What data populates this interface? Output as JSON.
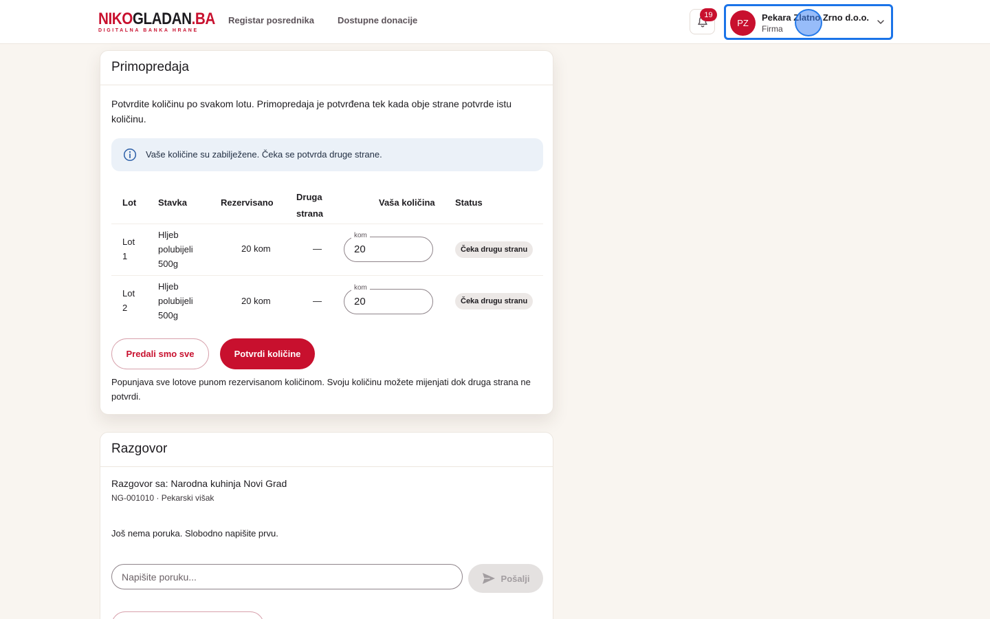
{
  "header": {
    "logo": {
      "main_a": "NIKO",
      "main_b": "GLADAN",
      "main_c": ".BA",
      "sub": "DIGITALNA BANKA HRANE"
    },
    "nav": [
      "Registar posrednika",
      "Dostupne donacije"
    ],
    "notifications": {
      "icon": "bell-icon",
      "count": "19"
    },
    "account": {
      "initials": "PZ",
      "name": "Pekara Zlatno Zrno d.o.o.",
      "role": "Firma",
      "icon": "chevron-down-icon"
    }
  },
  "handover": {
    "title": "Primopredaja",
    "intro": "Potvrdite količinu po svakom lotu. Primopredaja je potvrđena tek kada obje strane potvrde istu količinu.",
    "info": "Vaše količine su zabilježene. Čeka se potvrda druge strane.",
    "columns": {
      "lot": "Lot",
      "item": "Stavka",
      "reserved": "Rezervisano",
      "other_a": "Druga",
      "other_b": "strana",
      "yours": "Vaša količina",
      "status": "Status"
    },
    "rows": [
      {
        "lot_a": "Lot",
        "lot_b": "1",
        "item_a": "Hljeb",
        "item_b": "polubijeli",
        "item_c": "500g",
        "reserved": "20 kom",
        "other": "—",
        "unit": "kom",
        "qty": "20",
        "status": "Čeka drugu stranu"
      },
      {
        "lot_a": "Lot",
        "lot_b": "2",
        "item_a": "Hljeb",
        "item_b": "polubijeli",
        "item_c": "500g",
        "reserved": "20 kom",
        "other": "—",
        "unit": "kom",
        "qty": "20",
        "status": "Čeka drugu stranu"
      }
    ],
    "btn_all": "Predali smo sve",
    "btn_confirm": "Potvrdi količine",
    "hint": "Popunjava sve lotove punom rezervisanom količinom. Svoju količinu možete mijenjati dok druga strana ne potvrdi."
  },
  "conversation": {
    "title": "Razgovor",
    "with": "Razgovor sa: Narodna kuhinja Novi Grad",
    "ref": "NG-001010 · Pekarski višak",
    "empty": "Još nema poruka. Slobodno napišite prvu.",
    "placeholder": "Napišite poruku...",
    "send": "Pošalji",
    "send_icon": "send-icon"
  },
  "colors": {
    "brand": "#c8102e",
    "focus": "#1a73e8",
    "background": "#f9f5f0",
    "info_bg": "#ebf1f8"
  }
}
